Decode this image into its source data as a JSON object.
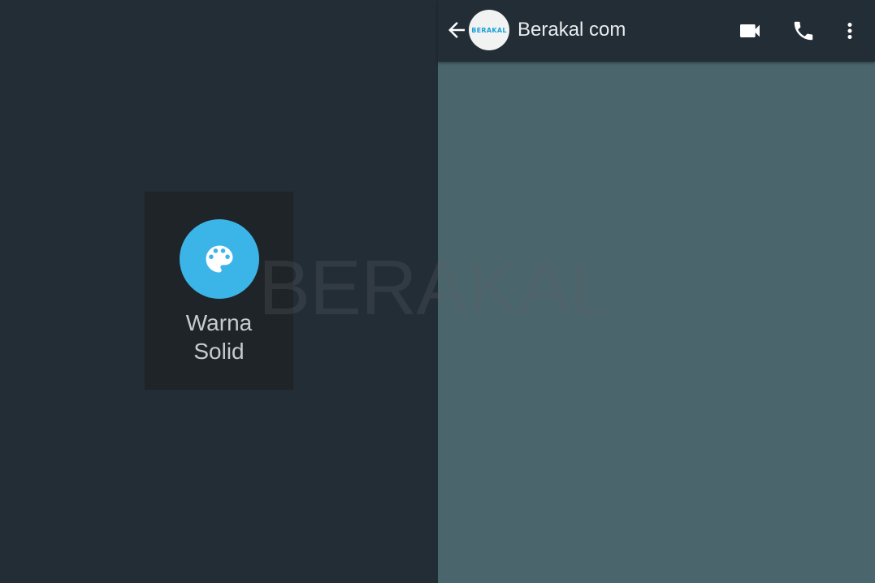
{
  "left_panel": {
    "option": {
      "label": "Warna\nSolid",
      "icon": "palette-icon"
    }
  },
  "header": {
    "contact_name": "Berakal com",
    "avatar_text": "BERAKAL",
    "icons": [
      "back-arrow-icon",
      "video-call-icon",
      "phone-icon",
      "more-vert-icon"
    ]
  },
  "watermark": "BERAKAL",
  "colors": {
    "background": "#232d36",
    "tile": "#1e2428",
    "accent": "#3bb5e8",
    "chat_wallpaper": "#4a666c",
    "header_text": "#e9edef"
  }
}
